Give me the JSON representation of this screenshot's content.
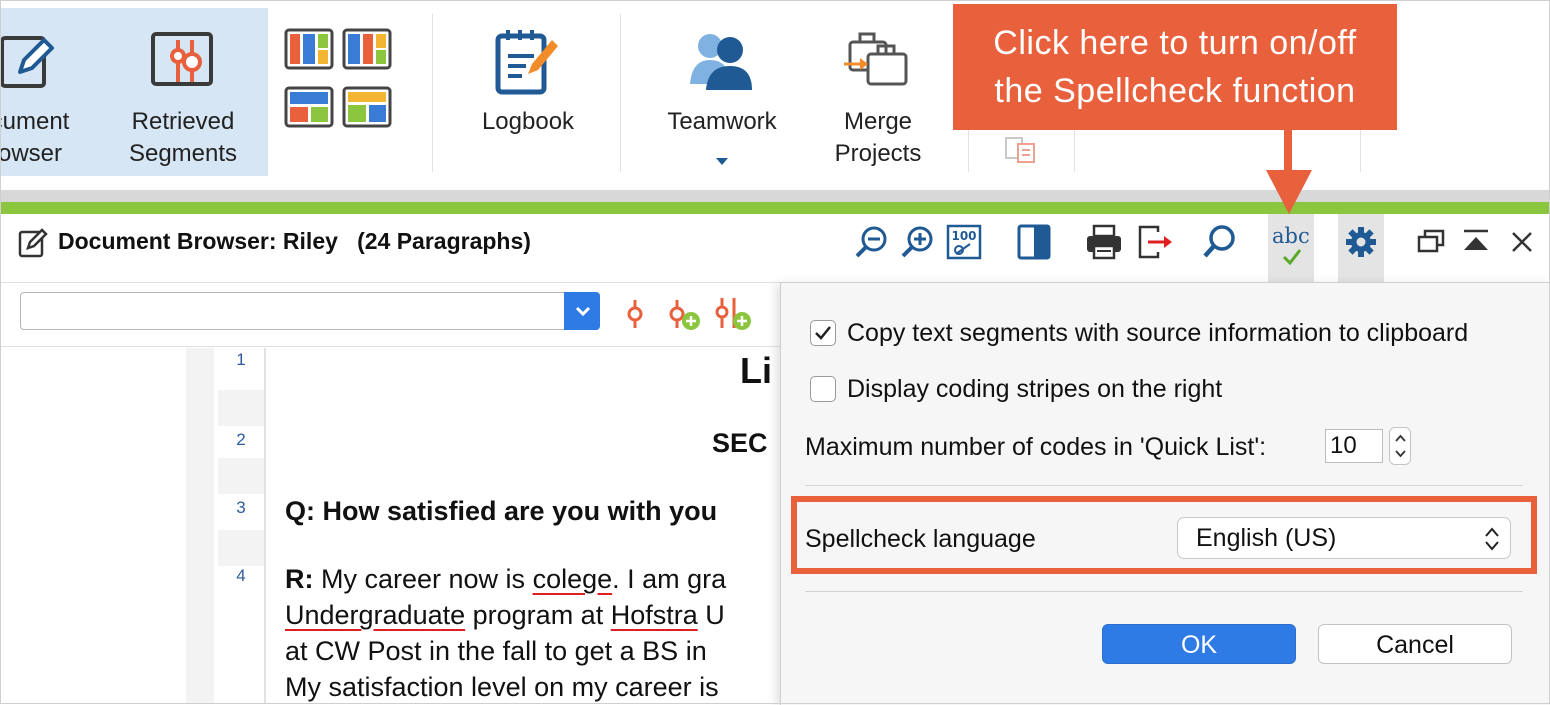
{
  "ribbon": {
    "document_browser_line1": "cument",
    "document_browser_line2": "owser",
    "retrieved_segments_line1": "Retrieved",
    "retrieved_segments_line2": "Segments",
    "logbook": "Logbook",
    "teamwork": "Teamwork",
    "merge_line1": "Merge",
    "merge_line2": "Projects"
  },
  "callout": {
    "line1": "Click here to turn on/off",
    "line2": "the Spellcheck function",
    "color": "#e8603c"
  },
  "document_browser": {
    "title": "Document Browser: Riley   (24 Paragraphs)",
    "spellcheck_icon_text": "abc"
  },
  "document": {
    "line_numbers": [
      "1",
      "2",
      "3",
      "4"
    ],
    "heading": "Li",
    "section": "SEC",
    "question": "Q: How satisfied are you with you",
    "r_label": "R:",
    "r_text_1": " My career now is ",
    "r_err_1": "colege",
    "r_text_2": ". I am gra",
    "r_err_2": "Undergraduate",
    "r_text_3": " program at ",
    "r_err_3": "Hofstra",
    "r_text_4": " U",
    "line_c": "at CW Post in the fall to get a BS in",
    "line_d": "My satisfaction level on my career is"
  },
  "popover": {
    "copy_segments_label": "Copy text segments with source information to clipboard",
    "copy_segments_checked": true,
    "coding_stripes_label": "Display coding stripes on the right",
    "coding_stripes_checked": false,
    "quick_list_label": "Maximum number of codes in 'Quick List':",
    "quick_list_value": "10",
    "spellcheck_label": "Spellcheck language",
    "spellcheck_value": "English (US)",
    "ok_label": "OK",
    "cancel_label": "Cancel"
  },
  "colors": {
    "accent_blue": "#2f7be6",
    "highlight_box": "#e8603c",
    "green_band": "#8cc63f",
    "icon_blue": "#1f5a94",
    "code_red": "#e8603c"
  }
}
